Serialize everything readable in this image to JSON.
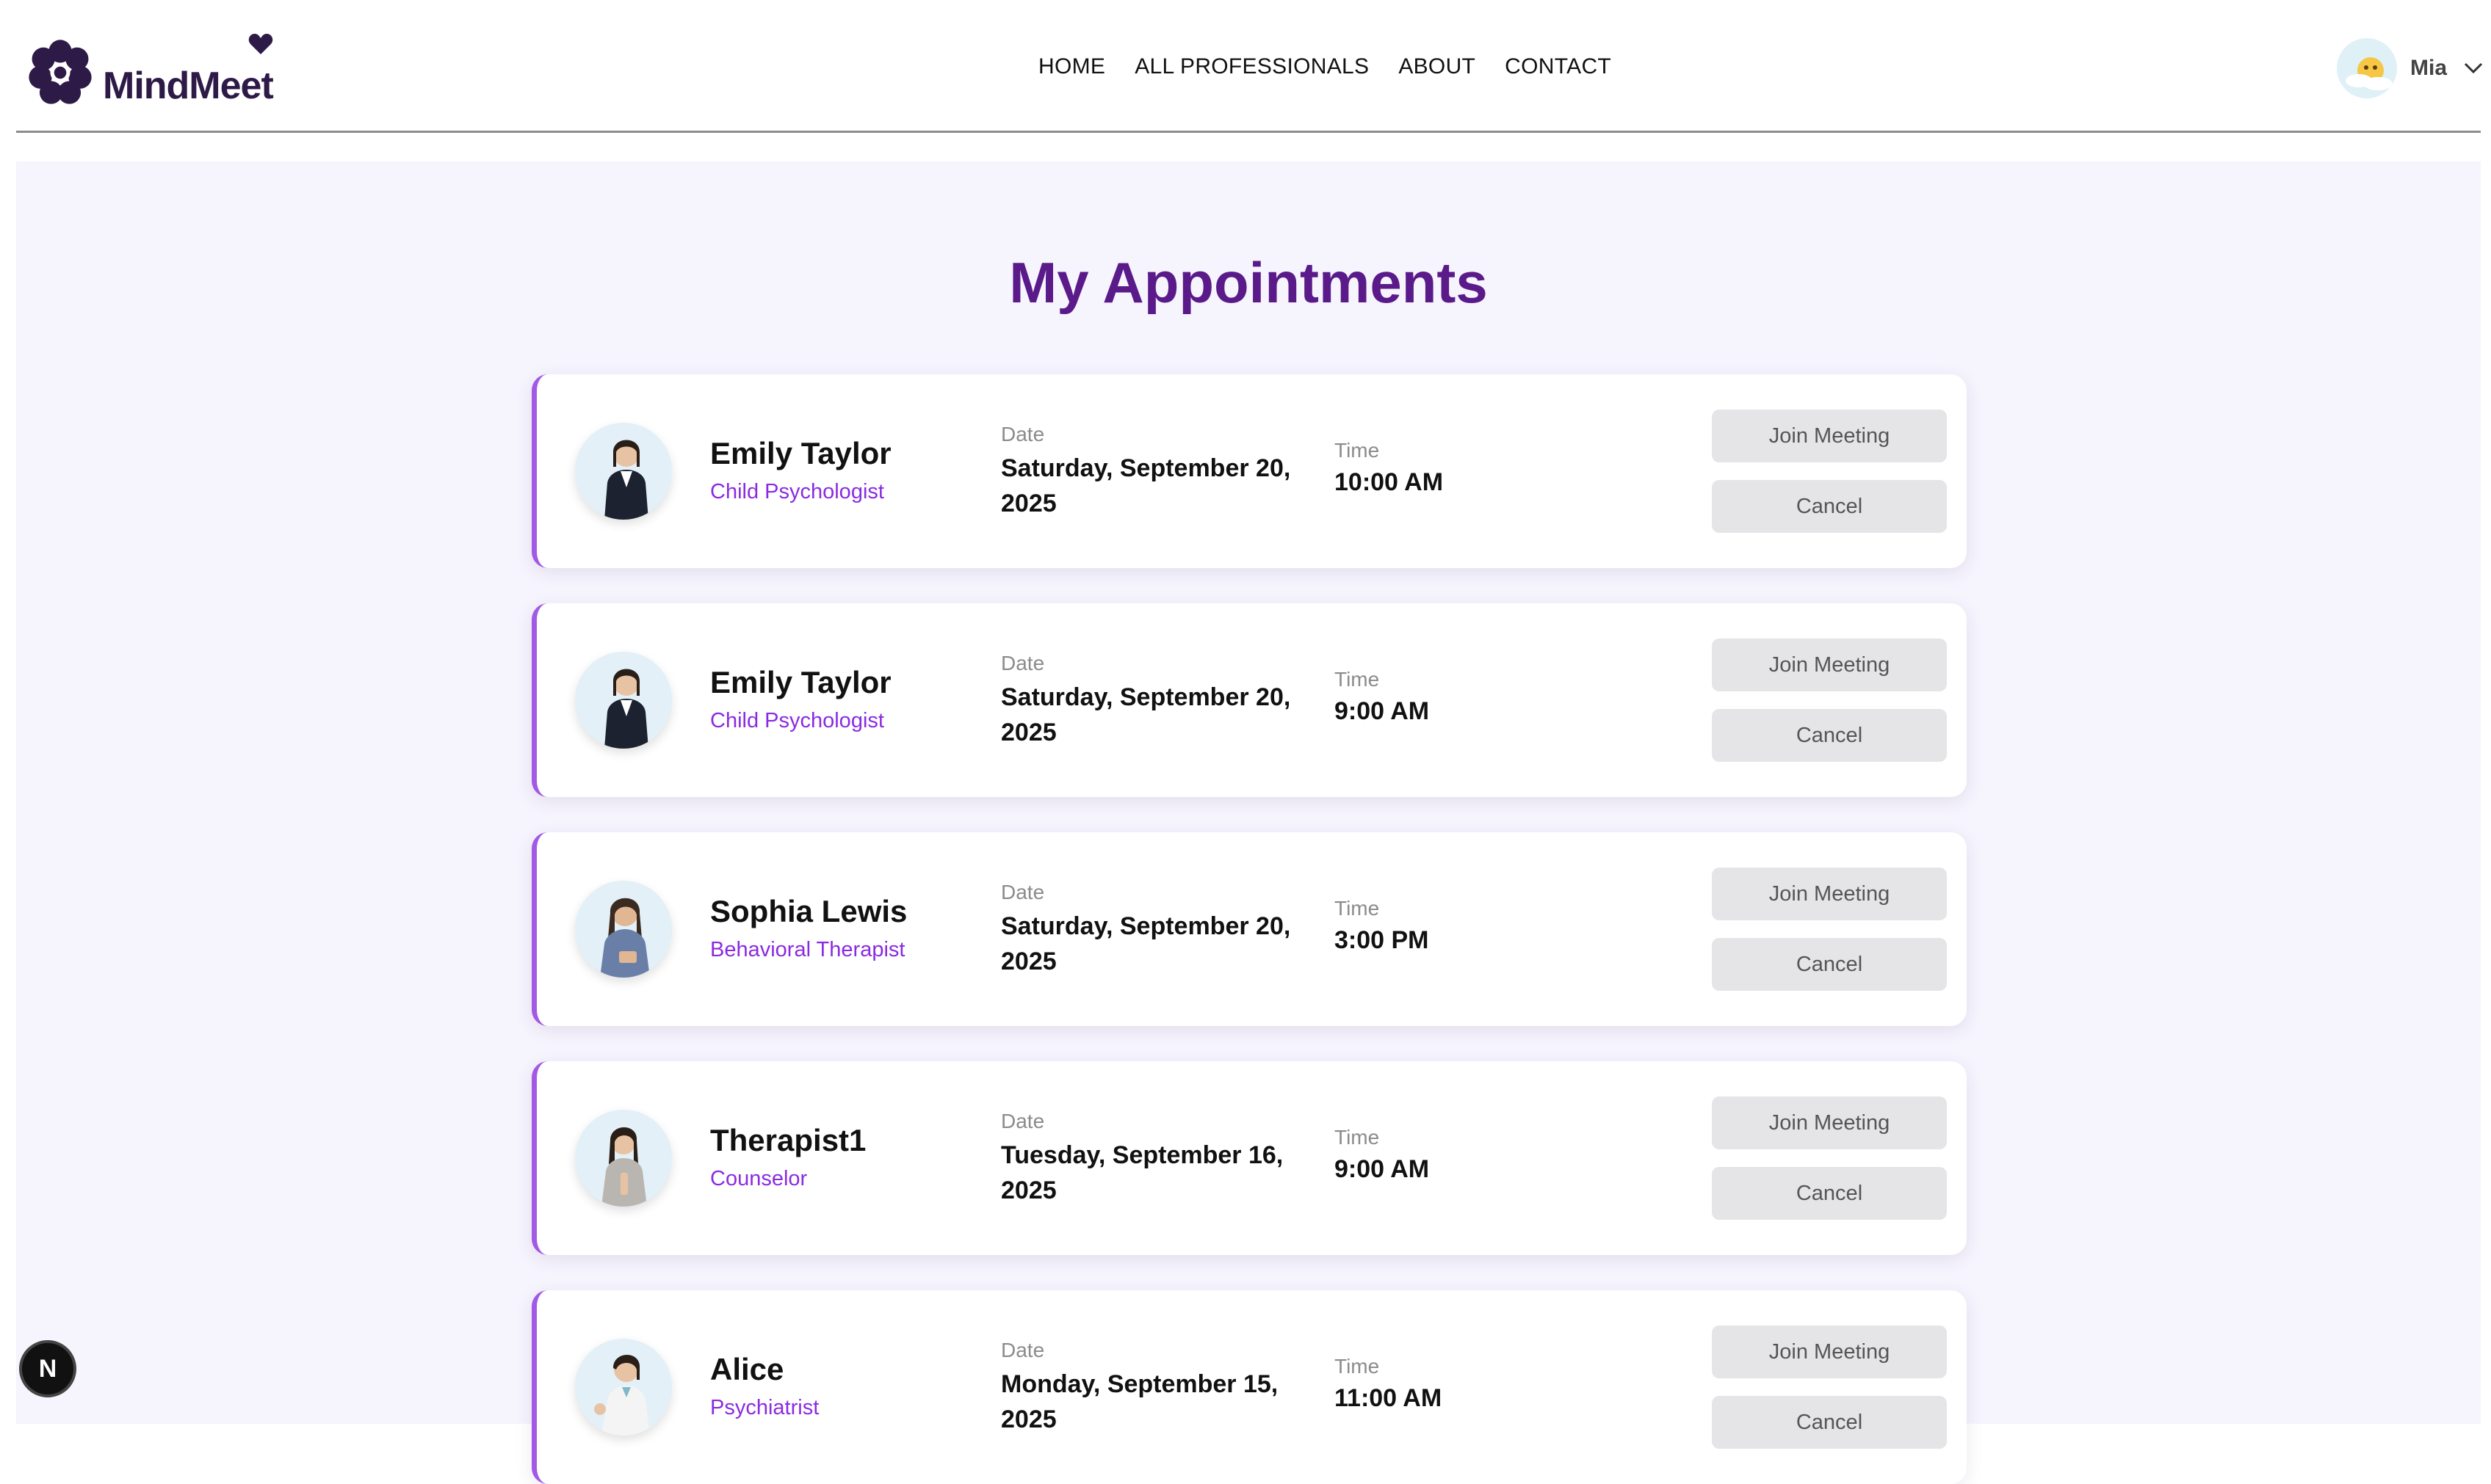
{
  "brand": {
    "name": "MindMeet"
  },
  "nav": {
    "items": [
      {
        "label": "HOME"
      },
      {
        "label": "ALL PROFESSIONALS"
      },
      {
        "label": "ABOUT"
      },
      {
        "label": "CONTACT"
      }
    ]
  },
  "user": {
    "name": "Mia"
  },
  "page": {
    "title": "My Appointments"
  },
  "appointments": [
    {
      "name": "Emily Taylor",
      "role": "Child Psychologist",
      "date_label": "Date",
      "date": "Saturday, September 20, 2025",
      "time_label": "Time",
      "time": "10:00 AM",
      "join_label": "Join Meeting",
      "cancel_label": "Cancel"
    },
    {
      "name": "Emily Taylor",
      "role": "Child Psychologist",
      "date_label": "Date",
      "date": "Saturday, September 20, 2025",
      "time_label": "Time",
      "time": "9:00 AM",
      "join_label": "Join Meeting",
      "cancel_label": "Cancel"
    },
    {
      "name": "Sophia Lewis",
      "role": "Behavioral Therapist",
      "date_label": "Date",
      "date": "Saturday, September 20, 2025",
      "time_label": "Time",
      "time": "3:00 PM",
      "join_label": "Join Meeting",
      "cancel_label": "Cancel"
    },
    {
      "name": "Therapist1",
      "role": "Counselor",
      "date_label": "Date",
      "date": "Tuesday, September 16, 2025",
      "time_label": "Time",
      "time": "9:00 AM",
      "join_label": "Join Meeting",
      "cancel_label": "Cancel"
    },
    {
      "name": "Alice",
      "role": "Psychiatrist",
      "date_label": "Date",
      "date": "Monday, September 15, 2025",
      "time_label": "Time",
      "time": "11:00 AM",
      "join_label": "Join Meeting",
      "cancel_label": "Cancel"
    }
  ],
  "dev_badge": {
    "letter": "N"
  },
  "colors": {
    "brand": "#2e1a47",
    "title": "#5a1a8a",
    "accent": "#a259e6",
    "role": "#8a2be2",
    "button_bg": "#e5e5e7",
    "page_bg": "#f6f4fd"
  },
  "icons": {
    "logo": "flower-logo-icon",
    "heart": "heart-icon",
    "chevron": "chevron-down-icon"
  }
}
